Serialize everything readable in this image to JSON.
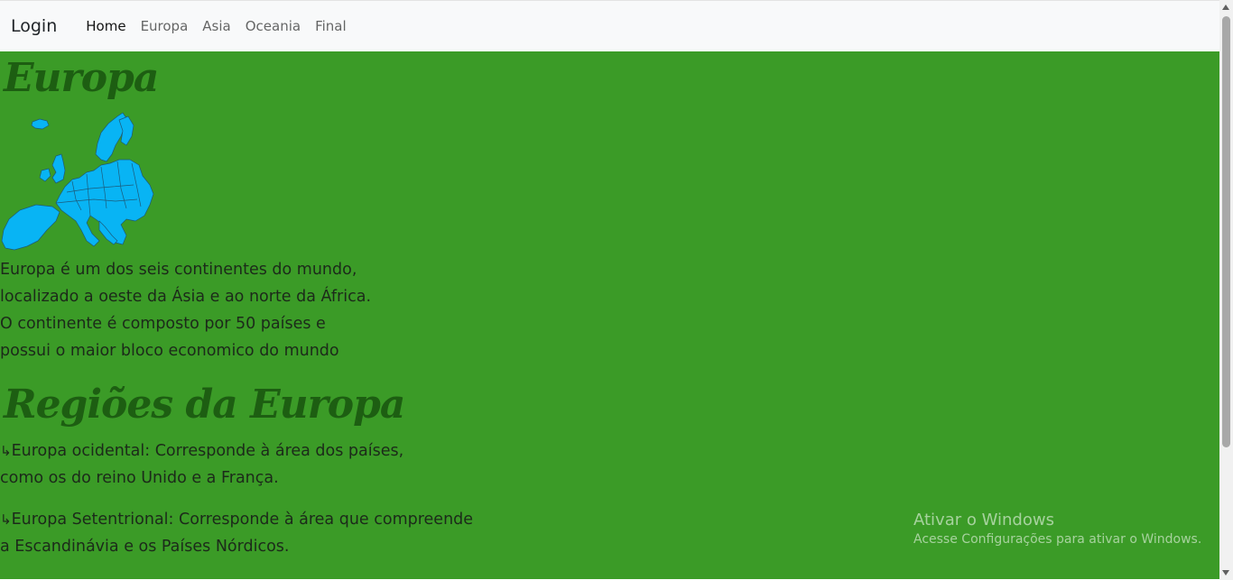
{
  "navbar": {
    "brand": "Login",
    "links": [
      "Home",
      "Europa",
      "Asia",
      "Oceania",
      "Final"
    ]
  },
  "content": {
    "title": "Europa",
    "map_alt": "europe-map",
    "intro_lines": [
      "Europa é um dos seis continentes do mundo,",
      "localizado a oeste da Ásia e ao norte da África.",
      "O continente é composto por 50 países e",
      "possui o maior bloco economico do mundo"
    ],
    "regions_title": "Regiões da Europa",
    "regions": [
      {
        "arrow": "↳",
        "lines": [
          "Europa ocidental: Corresponde à área dos países,",
          "como os do reino Unido e a França."
        ]
      },
      {
        "arrow": "↳",
        "lines": [
          "Europa Setentrional: Corresponde à área que compreende",
          "a Escandinávia e os Países Nórdicos."
        ]
      }
    ]
  },
  "watermark": {
    "title": "Ativar o Windows",
    "subtitle": "Acesse Configurações para ativar o Windows."
  },
  "colors": {
    "background": "#3b9b27",
    "heading": "#1d5e12",
    "map": "#08b4f4",
    "navbar": "#f8f9fa"
  }
}
